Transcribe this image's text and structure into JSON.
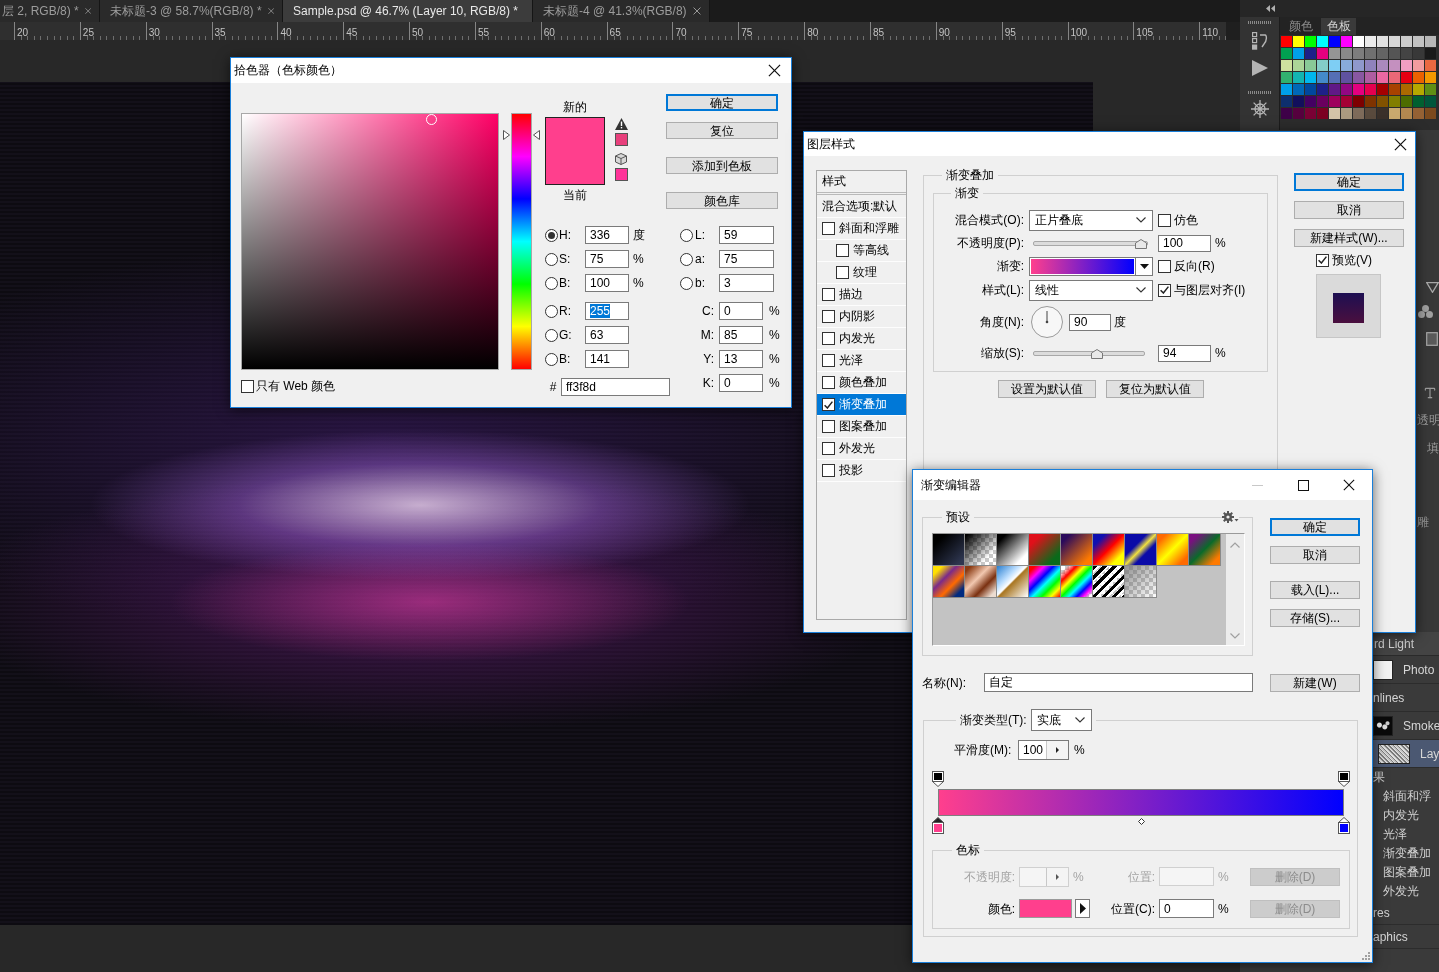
{
  "document_tabs": [
    {
      "label": "层 2, RGB/8) *",
      "selected": false
    },
    {
      "label": "未标题-3 @ 58.7%(RGB/8) *",
      "selected": false
    },
    {
      "label": "Sample.psd @ 46.7% (Layer 10, RGB/8) *",
      "selected": true
    },
    {
      "label": "未标题-4 @ 41.3%(RGB/8)",
      "selected": false
    }
  ],
  "ruler": {
    "labels": [
      "20",
      "25",
      "30",
      "35",
      "40",
      "45",
      "50",
      "55",
      "60",
      "65",
      "70",
      "75",
      "80",
      "85",
      "90",
      "95",
      "100",
      "105",
      "110"
    ]
  },
  "swatches_panel": {
    "tabs": [
      {
        "label": "颜色",
        "selected": false
      },
      {
        "label": "色板",
        "selected": true
      }
    ],
    "swatches": [
      {
        "color": "#ff0000"
      },
      {
        "color": "#ffff00"
      },
      {
        "color": "#00ff00"
      },
      {
        "color": "#00ffff"
      },
      {
        "color": "#0000ff"
      },
      {
        "color": "#ff00ff"
      },
      {
        "color": "#ffffff"
      },
      {
        "color": "#ebebeb"
      },
      {
        "color": "#e1e1e1"
      },
      {
        "color": "#d7d7d7"
      },
      {
        "color": "#cccccc"
      },
      {
        "color": "#c2c2c2"
      },
      {
        "color": "#b7b7b7"
      },
      {
        "color": "#00a051"
      },
      {
        "color": "#00a0e9"
      },
      {
        "color": "#1d2088"
      },
      {
        "color": "#e4007f"
      },
      {
        "color": "#959595"
      },
      {
        "color": "#898989"
      },
      {
        "color": "#7d7d7d"
      },
      {
        "color": "#707070"
      },
      {
        "color": "#646464"
      },
      {
        "color": "#555555"
      },
      {
        "color": "#444444"
      },
      {
        "color": "#383838"
      },
      {
        "color": "#1a1a1a"
      },
      {
        "color": "#cfe29f"
      },
      {
        "color": "#acd598"
      },
      {
        "color": "#89c997"
      },
      {
        "color": "#84ccc9"
      },
      {
        "color": "#7ecef4"
      },
      {
        "color": "#88abda"
      },
      {
        "color": "#8f98cb"
      },
      {
        "color": "#8f82bc"
      },
      {
        "color": "#aa89bd"
      },
      {
        "color": "#c490bf"
      },
      {
        "color": "#f19ec2"
      },
      {
        "color": "#f29c9f"
      },
      {
        "color": "#ea6941"
      },
      {
        "color": "#31b16f"
      },
      {
        "color": "#13b5b1"
      },
      {
        "color": "#00b7ee"
      },
      {
        "color": "#448aca"
      },
      {
        "color": "#556fb5"
      },
      {
        "color": "#5f52a0"
      },
      {
        "color": "#8957a1"
      },
      {
        "color": "#ae5da1"
      },
      {
        "color": "#ea68a2"
      },
      {
        "color": "#eb6877"
      },
      {
        "color": "#e60012"
      },
      {
        "color": "#eb6100"
      },
      {
        "color": "#f39800"
      },
      {
        "color": "#00a0e9"
      },
      {
        "color": "#0068b7"
      },
      {
        "color": "#00479d"
      },
      {
        "color": "#1d2088"
      },
      {
        "color": "#601986"
      },
      {
        "color": "#920783"
      },
      {
        "color": "#e4007f"
      },
      {
        "color": "#e5004f"
      },
      {
        "color": "#a40000"
      },
      {
        "color": "#a84200"
      },
      {
        "color": "#ac6a00"
      },
      {
        "color": "#b5a900"
      },
      {
        "color": "#5f8f14"
      },
      {
        "color": "#0d2f6e"
      },
      {
        "color": "#120f5c"
      },
      {
        "color": "#440062"
      },
      {
        "color": "#6a005f"
      },
      {
        "color": "#9e005d"
      },
      {
        "color": "#a40035"
      },
      {
        "color": "#7d0000"
      },
      {
        "color": "#7f3300"
      },
      {
        "color": "#815200"
      },
      {
        "color": "#827e00"
      },
      {
        "color": "#4c6c00"
      },
      {
        "color": "#006030"
      },
      {
        "color": "#00563b"
      },
      {
        "color": "#3e0048"
      },
      {
        "color": "#56003e"
      },
      {
        "color": "#7a0035"
      },
      {
        "color": "#7c0022"
      },
      {
        "color": "#d4c4a8"
      },
      {
        "color": "#aa9a80"
      },
      {
        "color": "#7e6b5a"
      },
      {
        "color": "#594a3d"
      },
      {
        "color": "#3a302a"
      },
      {
        "color": "#c9a96e"
      },
      {
        "color": "#b28850"
      },
      {
        "color": "#956134"
      },
      {
        "color": "#7c4a1e"
      }
    ]
  },
  "color_picker": {
    "title": "拾色器（色标颜色）",
    "hue_slider": {
      "level": 0.933
    },
    "preview": [
      {
        "label": "新的",
        "color": "#ff3f8d"
      },
      {
        "label": "当前",
        "color": "#ff3f8d"
      }
    ],
    "warnings": [
      {
        "kind": "gamut",
        "color": "#e8407c"
      },
      {
        "kind": "web",
        "color": "#ff3399"
      }
    ],
    "buttons": [
      {
        "label": "确定",
        "focused": true
      },
      {
        "label": "复位",
        "focused": false
      },
      {
        "label": "添加到色板",
        "focused": false
      },
      {
        "label": "颜色库",
        "focused": false
      }
    ],
    "hsb": [
      {
        "label": "H:",
        "value": "336",
        "unit": "度",
        "selected": true
      },
      {
        "label": "S:",
        "value": "75",
        "unit": "%",
        "selected": false
      },
      {
        "label": "B:",
        "value": "100",
        "unit": "%",
        "selected": false
      }
    ],
    "rgb": [
      {
        "label": "R:",
        "value": "255",
        "selected": false,
        "text_selected": true
      },
      {
        "label": "G:",
        "value": "63",
        "selected": false,
        "text_selected": false
      },
      {
        "label": "B:",
        "value": "141",
        "selected": false,
        "text_selected": false
      }
    ],
    "hex": {
      "label": "#",
      "value": "ff3f8d"
    },
    "lab": [
      {
        "label": "L:",
        "value": "59",
        "selected": false
      },
      {
        "label": "a:",
        "value": "75",
        "selected": false
      },
      {
        "label": "b:",
        "value": "3",
        "selected": false
      }
    ],
    "cmyk": [
      {
        "label": "C:",
        "value": "0",
        "unit": "%"
      },
      {
        "label": "M:",
        "value": "85",
        "unit": "%"
      },
      {
        "label": "Y:",
        "value": "13",
        "unit": "%"
      },
      {
        "label": "K:",
        "value": "0",
        "unit": "%"
      }
    ],
    "web_only": {
      "label": "只有 Web 颜色",
      "checked": false
    }
  },
  "layer_style": {
    "title": "图层样式",
    "list_header": "样式",
    "blending_options": "混合选项:默认",
    "effects": [
      {
        "label": "斜面和浮雕",
        "checked": false,
        "selected": false,
        "children": [
          {
            "label": "等高线",
            "checked": false,
            "selected": false
          },
          {
            "label": "纹理",
            "checked": false,
            "selected": false
          }
        ]
      },
      {
        "label": "描边",
        "checked": false,
        "selected": false
      },
      {
        "label": "内阴影",
        "checked": false,
        "selected": false
      },
      {
        "label": "内发光",
        "checked": false,
        "selected": false
      },
      {
        "label": "光泽",
        "checked": false,
        "selected": false
      },
      {
        "label": "颜色叠加",
        "checked": false,
        "selected": false
      },
      {
        "label": "渐变叠加",
        "checked": true,
        "selected": true
      },
      {
        "label": "图案叠加",
        "checked": false,
        "selected": false
      },
      {
        "label": "外发光",
        "checked": false,
        "selected": false
      },
      {
        "label": "投影",
        "checked": false,
        "selected": false
      }
    ],
    "section_title": "渐变叠加",
    "group_title": "渐变",
    "blend_mode": {
      "label": "混合模式(O):",
      "value": "正片叠底"
    },
    "dither": {
      "label": "仿色",
      "checked": false
    },
    "opacity": {
      "label": "不透明度(P):",
      "level": 1,
      "value": "100",
      "unit": "%"
    },
    "gradient": {
      "label": "渐变:"
    },
    "reverse": {
      "label": "反向(R)",
      "checked": false
    },
    "style": {
      "label": "样式(L):",
      "value": "线性"
    },
    "align": {
      "label": "与图层对齐(I)",
      "checked": true
    },
    "angle": {
      "label": "角度(N):",
      "value": "90",
      "unit": "度"
    },
    "scale": {
      "label": "缩放(S):",
      "level": 0.58,
      "value": "94",
      "unit": "%"
    },
    "default_buttons": [
      "设置为默认值",
      "复位为默认值"
    ],
    "buttons": [
      {
        "label": "确定",
        "focused": true
      },
      {
        "label": "取消",
        "focused": false
      },
      {
        "label": "新建样式(W)...",
        "focused": false
      }
    ],
    "preview": {
      "label": "预览(V)",
      "checked": true
    }
  },
  "gradient_editor": {
    "title": "渐变编辑器",
    "window_buttons": [
      {
        "kind": "minimize",
        "disabled": true
      },
      {
        "kind": "maximize",
        "disabled": false
      },
      {
        "kind": "close",
        "disabled": false
      }
    ],
    "presets_title": "预设",
    "presets": [
      {
        "kind": "foreground"
      },
      {
        "kind": "fade"
      },
      {
        "kind": "monochrome"
      },
      {
        "kind": "duo"
      },
      {
        "kind": "sunset"
      },
      {
        "kind": "triad"
      },
      {
        "kind": "band"
      },
      {
        "kind": "glow"
      },
      {
        "kind": "tricolor"
      },
      {
        "kind": "quad"
      },
      {
        "kind": "copper"
      },
      {
        "kind": "chrome"
      },
      {
        "kind": "spectrum"
      },
      {
        "kind": "rainbow"
      },
      {
        "kind": "stripes"
      },
      {
        "kind": "neutral"
      }
    ],
    "buttons": [
      {
        "label": "确定",
        "focused": true
      },
      {
        "label": "取消",
        "focused": false
      },
      {
        "label": "载入(L)...",
        "focused": false
      },
      {
        "label": "存储(S)...",
        "focused": false
      }
    ],
    "name": {
      "label": "名称(N):",
      "value": "自定"
    },
    "new_button": "新建(W)",
    "type": {
      "label": "渐变类型(T):",
      "value": "实底"
    },
    "smoothness": {
      "label": "平滑度(M):",
      "value": "100",
      "unit": "%"
    },
    "opacity_stops": [
      {
        "color": "#000000",
        "selected": false
      },
      {
        "color": "#000000",
        "selected": false
      }
    ],
    "color_stops": [
      {
        "color": "#ff3f8d",
        "selected": true
      },
      {
        "color": "#0000ff",
        "selected": false
      }
    ],
    "stop_settings": {
      "title": "色标",
      "opacity": {
        "label": "不透明度:",
        "unit": "%",
        "disabled": true
      },
      "opacity_location": {
        "label": "位置:",
        "unit": "%",
        "disabled": true
      },
      "opacity_delete": {
        "label": "删除(D)",
        "disabled": true
      },
      "color": {
        "label": "颜色:"
      },
      "color_location": {
        "label": "位置(C):",
        "value": "0",
        "unit": "%"
      },
      "color_delete": {
        "label": "删除(D)",
        "disabled": true
      }
    }
  },
  "side_panel": {
    "labels": [
      "透明",
      "填",
      "雕"
    ]
  },
  "layers_panel": {
    "blend_mode": "rd Light",
    "layers": [
      {
        "name": "Photo",
        "kind": "light-thumb",
        "selected": false
      },
      {
        "name": "nlines",
        "kind": "group",
        "selected": false
      },
      {
        "name": "Smoke",
        "kind": "dark-thumb",
        "selected": false
      },
      {
        "name": "Lay",
        "kind": "noise-thumb",
        "selected": true,
        "effects_title": "果",
        "effects": [
          "斜面和浮",
          "内发光",
          "光泽",
          "渐变叠加",
          "图案叠加",
          "外发光"
        ]
      },
      {
        "name": "res",
        "kind": "group",
        "selected": false
      },
      {
        "name": "aphics",
        "kind": "group",
        "selected": false
      }
    ]
  }
}
